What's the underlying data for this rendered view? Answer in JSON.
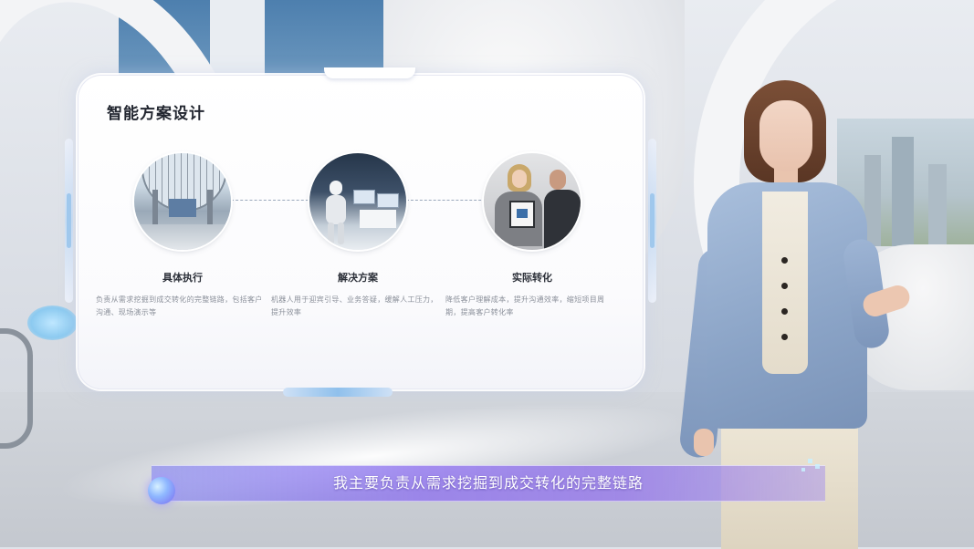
{
  "panel": {
    "title": "智能方案设计",
    "items": [
      {
        "title": "具体执行",
        "desc": "负责从需求挖掘到成交转化的完整链路，包括客户沟通、现场演示等"
      },
      {
        "title": "解决方案",
        "desc": "机器人用于迎宾引导、业务答疑，缓解人工压力，提升效率"
      },
      {
        "title": "实际转化",
        "desc": "降低客户理解成本，提升沟通效率，缩短项目周期，提高客户转化率"
      }
    ]
  },
  "subtitle": {
    "text": "我主要负责从需求挖掘到成交转化的完整链路"
  },
  "colors": {
    "subtitle_gradient_start": "#7878f5",
    "subtitle_gradient_mid": "#8c6ef0",
    "panel_background": "#ffffff",
    "title_text": "#222630",
    "desc_text": "#8b909a"
  }
}
